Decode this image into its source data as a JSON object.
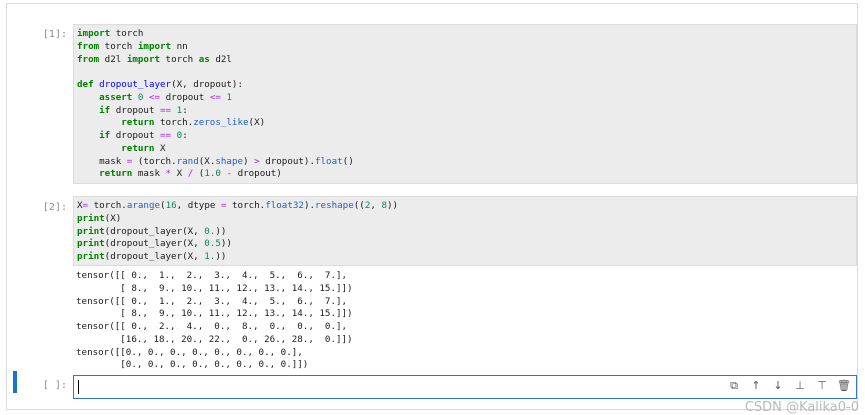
{
  "cells": [
    {
      "prompt": "[1]:",
      "code_lines": [
        "import torch",
        "from torch import nn",
        "from d2l import torch as d2l",
        "",
        "def dropout_layer(X, dropout):",
        "    assert 0 <= dropout <= 1",
        "    if dropout == 1:",
        "        return torch.zeros_like(X)",
        "    if dropout == 0:",
        "        return X",
        "    mask = (torch.rand(X.shape) > dropout).float()",
        "    return mask * X / (1.0 - dropout)"
      ]
    },
    {
      "prompt": "[2]:",
      "code_lines": [
        "X= torch.arange(16, dtype = torch.float32).reshape((2, 8))",
        "print(X)",
        "print(dropout_layer(X, 0.))",
        "print(dropout_layer(X, 0.5))",
        "print(dropout_layer(X, 1.))"
      ],
      "output_lines": [
        "tensor([[ 0.,  1.,  2.,  3.,  4.,  5.,  6.,  7.],",
        "        [ 8.,  9., 10., 11., 12., 13., 14., 15.]])",
        "tensor([[ 0.,  1.,  2.,  3.,  4.,  5.,  6.,  7.],",
        "        [ 8.,  9., 10., 11., 12., 13., 14., 15.]])",
        "tensor([[ 0.,  2.,  4.,  0.,  8.,  0.,  0.,  0.],",
        "        [16., 18., 20., 22.,  0., 26., 28.,  0.]])",
        "tensor([[0., 0., 0., 0., 0., 0., 0., 0.],",
        "        [0., 0., 0., 0., 0., 0., 0., 0.]])"
      ]
    }
  ],
  "empty_cell": {
    "prompt": "[ ]:"
  },
  "toolbar": {
    "icons": [
      "copy-icon",
      "move-up-icon",
      "move-down-icon",
      "insert-above-icon",
      "insert-below-icon",
      "delete-icon"
    ],
    "glyphs": [
      "⧉",
      "↑",
      "↓",
      "⊥",
      "⊤",
      "🗑"
    ]
  },
  "watermark": "CSDN @Kalika0-0"
}
